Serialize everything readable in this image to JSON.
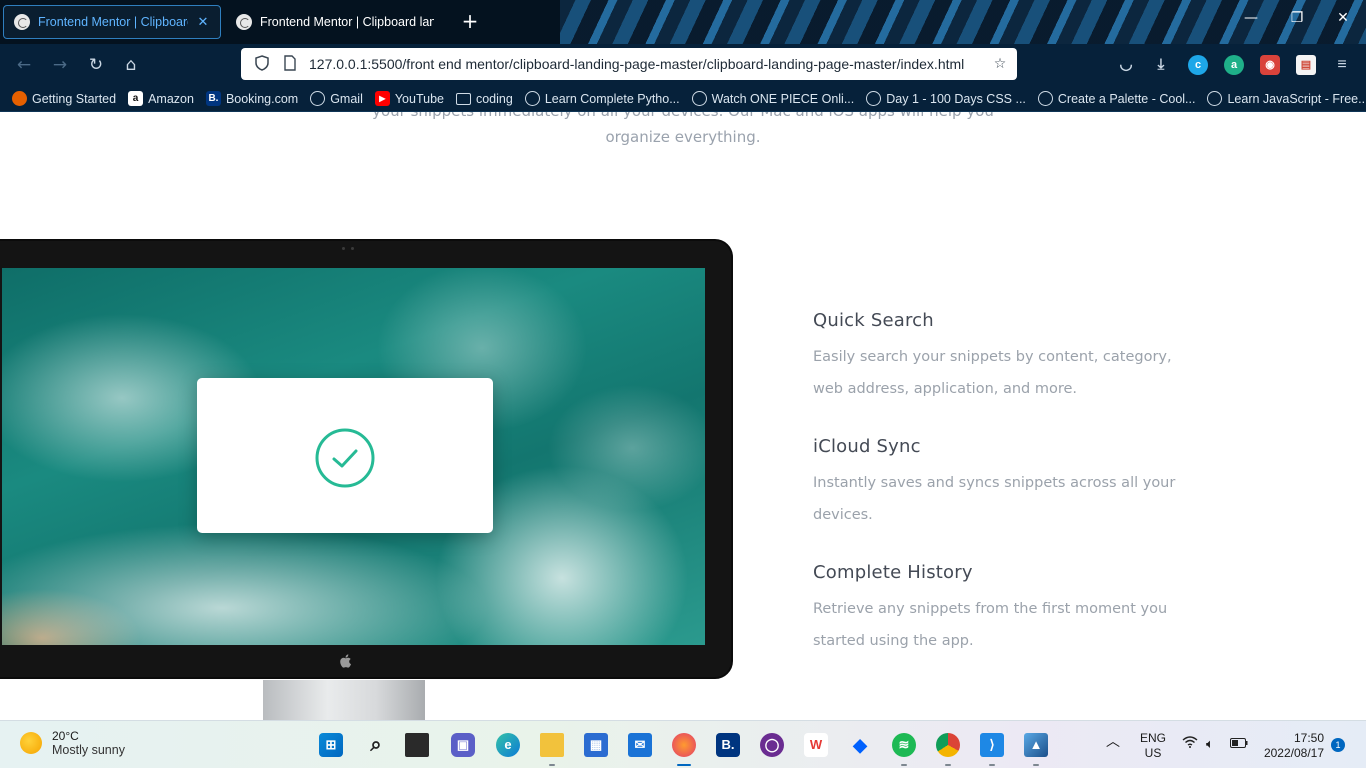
{
  "browser": {
    "tabs": [
      {
        "title": "Frontend Mentor | Clipboard lan",
        "active": true
      },
      {
        "title": "Frontend Mentor | Clipboard lan",
        "active": false
      }
    ],
    "new_tab_label": "+",
    "window_controls": {
      "minimize": "—",
      "restore": "❐",
      "close": "✕"
    },
    "url": "127.0.0.1:5500/front end mentor/clipboard-landing-page-master/clipboard-landing-page-master/index.html",
    "bookmarks": [
      {
        "label": "Getting Started",
        "icon": "firefox-icon",
        "color": "#e66000"
      },
      {
        "label": "Amazon",
        "icon": "amazon-icon",
        "color": "#ffffff"
      },
      {
        "label": "Booking.com",
        "icon": "booking-icon",
        "color": "#003580"
      },
      {
        "label": "Gmail",
        "icon": "globe-icon"
      },
      {
        "label": "YouTube",
        "icon": "youtube-icon",
        "color": "#ff0000"
      },
      {
        "label": "coding",
        "icon": "folder-icon"
      },
      {
        "label": "Learn Complete Pytho...",
        "icon": "globe-icon"
      },
      {
        "label": "Watch ONE PIECE Onli...",
        "icon": "globe-icon"
      },
      {
        "label": "Day 1 - 100 Days CSS ...",
        "icon": "globe-icon"
      },
      {
        "label": "Create a Palette - Cool...",
        "icon": "globe-icon"
      },
      {
        "label": "Learn JavaScript - Free...",
        "icon": "globe-icon"
      }
    ]
  },
  "page": {
    "intro_partial": "your snippets immediately on all your devices. Our Mac and iOS apps will help you organize everything.",
    "features": [
      {
        "title": "Quick Search",
        "text": "Easily search your snippets by content, category, web address, application, and more."
      },
      {
        "title": "iCloud Sync",
        "text": "Instantly saves and syncs snippets across all your devices."
      },
      {
        "title": "Complete History",
        "text": "Retrieve any snippets from the first moment you started using the app."
      }
    ],
    "accent_color": "#26ba95"
  },
  "taskbar": {
    "weather_temp": "20°C",
    "weather_desc": "Mostly sunny",
    "language": "ENG",
    "region": "US",
    "time": "17:50",
    "date": "2022/08/17",
    "notification_count": "1"
  }
}
